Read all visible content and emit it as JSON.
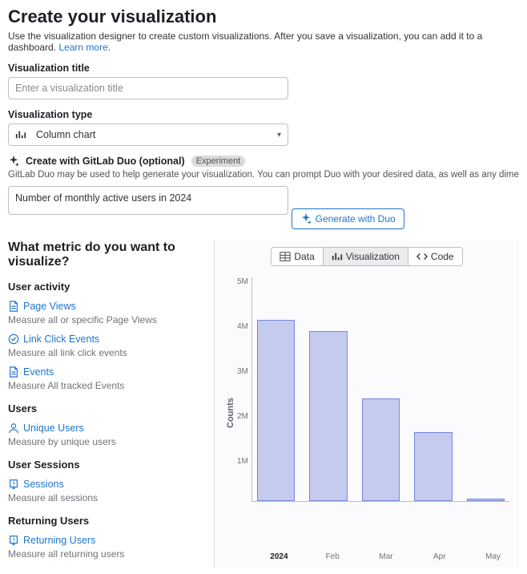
{
  "header": {
    "title": "Create your visualization",
    "subtitle_a": "Use the visualization designer to create custom visualizations. After you save a visualization, you can add it to a dashboard. ",
    "learn_more": "Learn more"
  },
  "form": {
    "viz_title_label": "Visualization title",
    "viz_title_placeholder": "Enter a visualization title",
    "viz_type_label": "Visualization type",
    "viz_type_value": "Column chart",
    "duo_label": "Create with GitLab Duo (optional)",
    "duo_badge": "Experiment",
    "duo_desc": "GitLab Duo may be used to help generate your visualization. You can prompt Duo with your desired data, as well as any dimensions or additional groupings of that data. You may",
    "duo_prompt_value": "Number of monthly active users in 2024",
    "duo_button": "Generate with Duo"
  },
  "metrics": {
    "heading": "What metric do you want to visualize?",
    "groups": [
      {
        "title": "User activity",
        "items": [
          {
            "label": "Page Views",
            "desc": "Measure all or specific Page Views",
            "icon": "doc"
          },
          {
            "label": "Link Click Events",
            "desc": "Measure all link click events",
            "icon": "check"
          },
          {
            "label": "Events",
            "desc": "Measure All tracked Events",
            "icon": "doc"
          }
        ]
      },
      {
        "title": "Users",
        "items": [
          {
            "label": "Unique Users",
            "desc": "Measure by unique users",
            "icon": "user"
          }
        ]
      },
      {
        "title": "User Sessions",
        "items": [
          {
            "label": "Sessions",
            "desc": "Measure all sessions",
            "icon": "session"
          }
        ]
      },
      {
        "title": "Returning Users",
        "items": [
          {
            "label": "Returning Users",
            "desc": "Measure all returning users",
            "icon": "session"
          }
        ]
      }
    ]
  },
  "viz_tabs": {
    "data": "Data",
    "visualization": "Visualization",
    "code": "Code"
  },
  "chart_data": {
    "type": "bar",
    "categories": [
      "2024",
      "Feb",
      "Mar",
      "Apr",
      "May"
    ],
    "values": [
      4050000,
      3800000,
      2300000,
      1550000,
      50000
    ],
    "ylabel": "Counts",
    "ylim": [
      0,
      5000000
    ],
    "y_ticks": [
      "5M",
      "4M",
      "3M",
      "2M",
      "1M",
      ""
    ]
  }
}
